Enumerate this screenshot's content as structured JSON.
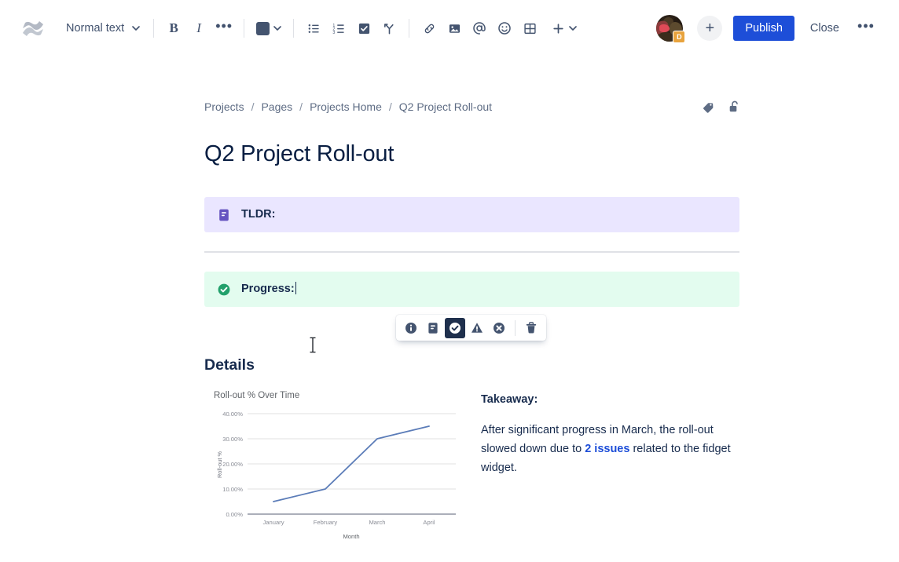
{
  "toolbar": {
    "logo_icon": "confluence-logo-icon",
    "text_style": {
      "label": "Normal text",
      "chevron": "chevron-down-icon"
    },
    "bold_label": "B",
    "italic_label": "I",
    "more_formatting_label": "•••",
    "text_color": {
      "name": "text-color-swatch",
      "hex": "#44546F"
    },
    "items": [
      {
        "name": "bullet-list-button",
        "icon": "bullet-list-icon"
      },
      {
        "name": "numbered-list-button",
        "icon": "numbered-list-icon"
      },
      {
        "name": "task-list-button",
        "icon": "checkbox-icon"
      },
      {
        "name": "decision-button",
        "icon": "decision-branch-icon"
      },
      {
        "name": "link-button",
        "icon": "link-icon"
      },
      {
        "name": "image-button",
        "icon": "image-icon"
      },
      {
        "name": "mention-button",
        "icon": "mention-at-icon"
      },
      {
        "name": "emoji-button",
        "icon": "emoji-smiley-icon"
      },
      {
        "name": "table-button",
        "icon": "table-icon"
      },
      {
        "name": "insert-more-button",
        "icon": "plus-icon"
      }
    ],
    "avatar": {
      "name": "user-avatar",
      "badge": "D"
    },
    "add_button_label": "+",
    "publish_label": "Publish",
    "close_label": "Close",
    "more_actions_label": "•••"
  },
  "breadcrumb": {
    "items": [
      "Projects",
      "Pages",
      "Projects Home",
      "Q2 Project Roll-out"
    ],
    "separator": "/",
    "actions": [
      {
        "name": "labels-tag-icon",
        "title": "Labels"
      },
      {
        "name": "unlocked-padlock-icon",
        "title": "Restrictions"
      }
    ]
  },
  "page": {
    "title": "Q2 Project Roll-out",
    "panels": [
      {
        "name": "tldr-panel",
        "type": "note",
        "icon": "note-icon",
        "text": "TLDR:",
        "bg": "#EAE6FF",
        "icon_color": "#6554C0"
      },
      {
        "name": "progress-panel",
        "type": "success",
        "icon": "success-check-icon",
        "text": "Progress:",
        "bg": "#E3FCEF",
        "icon_color": "#22A06B"
      }
    ],
    "details_heading": "Details",
    "takeaway": {
      "heading": "Takeaway:",
      "text_before": "After significant progress in March, the roll-out slowed down due to ",
      "link": "2 issues",
      "text_after": " related to the fidget widget."
    }
  },
  "panel_toolbar": {
    "options": [
      {
        "name": "panel-type-info",
        "icon": "info-circle-icon",
        "selected": false
      },
      {
        "name": "panel-type-note",
        "icon": "note-icon",
        "selected": false
      },
      {
        "name": "panel-type-success",
        "icon": "success-check-icon",
        "selected": true
      },
      {
        "name": "panel-type-warning",
        "icon": "warning-triangle-icon",
        "selected": false
      },
      {
        "name": "panel-type-error",
        "icon": "error-cross-icon",
        "selected": false
      },
      {
        "name": "panel-remove",
        "icon": "trash-icon",
        "selected": false
      }
    ]
  },
  "chart_data": {
    "type": "line",
    "title": "Roll-out % Over Time",
    "xlabel": "Month",
    "ylabel": "Roll-out %",
    "categories": [
      "January",
      "February",
      "March",
      "April"
    ],
    "values": [
      5,
      10,
      30,
      35
    ],
    "ytick_labels": [
      "0.00%",
      "10.00%",
      "20.00%",
      "30.00%",
      "40.00%"
    ],
    "yticks": [
      0,
      10,
      20,
      30,
      40
    ],
    "ylim": [
      0,
      40
    ],
    "grid": true,
    "legend": "none",
    "series_color": "#5B7CB8"
  }
}
